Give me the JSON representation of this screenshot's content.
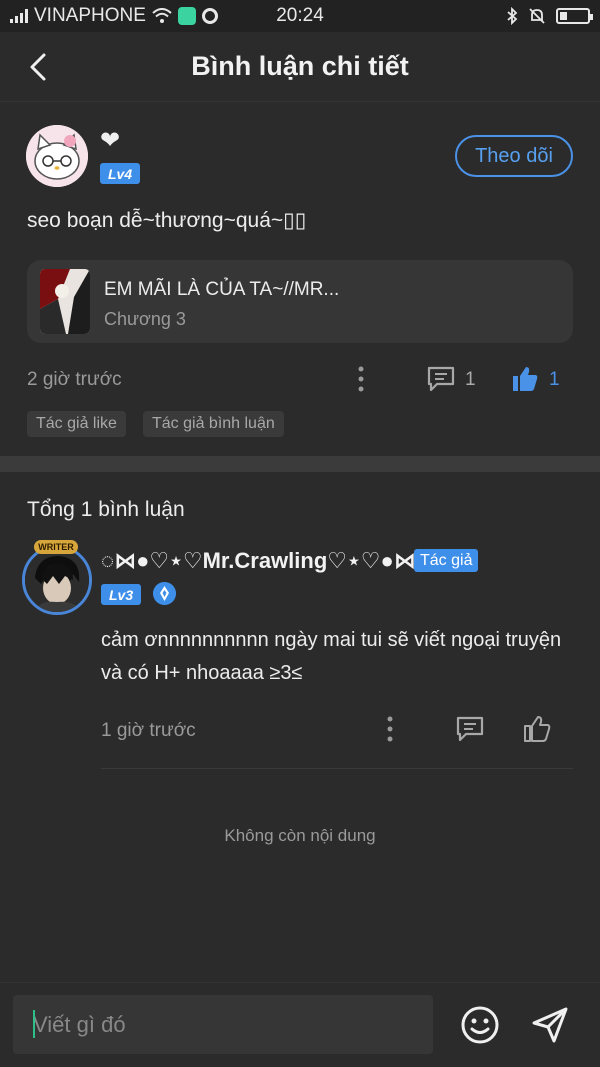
{
  "status_bar": {
    "carrier": "VINAPHONE",
    "time": "20:24"
  },
  "header": {
    "title": "Bình luận chi tiết"
  },
  "post": {
    "username": "❤",
    "level": "Lv4",
    "follow_label": "Theo dõi",
    "text": "seo boạn dễ~thương~quá~▯▯",
    "story": {
      "title": "EM MÃI LÀ CỦA TA~//MR...",
      "chapter": "Chương 3"
    },
    "time": "2 giờ trước",
    "comment_count": "1",
    "like_count": "1",
    "tags": [
      "Tác giả like",
      "Tác giả bình luận"
    ]
  },
  "comments": {
    "total_label": "Tổng 1 bình luận",
    "items": [
      {
        "writer_badge": "WRITER",
        "username": "◌⋈●♡⋆♡Mr.Crawling♡⋆♡●⋈◌",
        "author_badge": "Tác giả",
        "level": "Lv3",
        "text": "cảm ơnnnnnnnnnn ngày mai tui sẽ viết ngoại truyện và có H+ nhoaaaa ≥3≤",
        "time": "1 giờ trước"
      }
    ],
    "no_more": "Không còn nội dung"
  },
  "composer": {
    "placeholder": "Viết gì đó"
  },
  "colors": {
    "background": "#2b2b2b",
    "accent": "#3e8fea",
    "card": "#363636"
  }
}
